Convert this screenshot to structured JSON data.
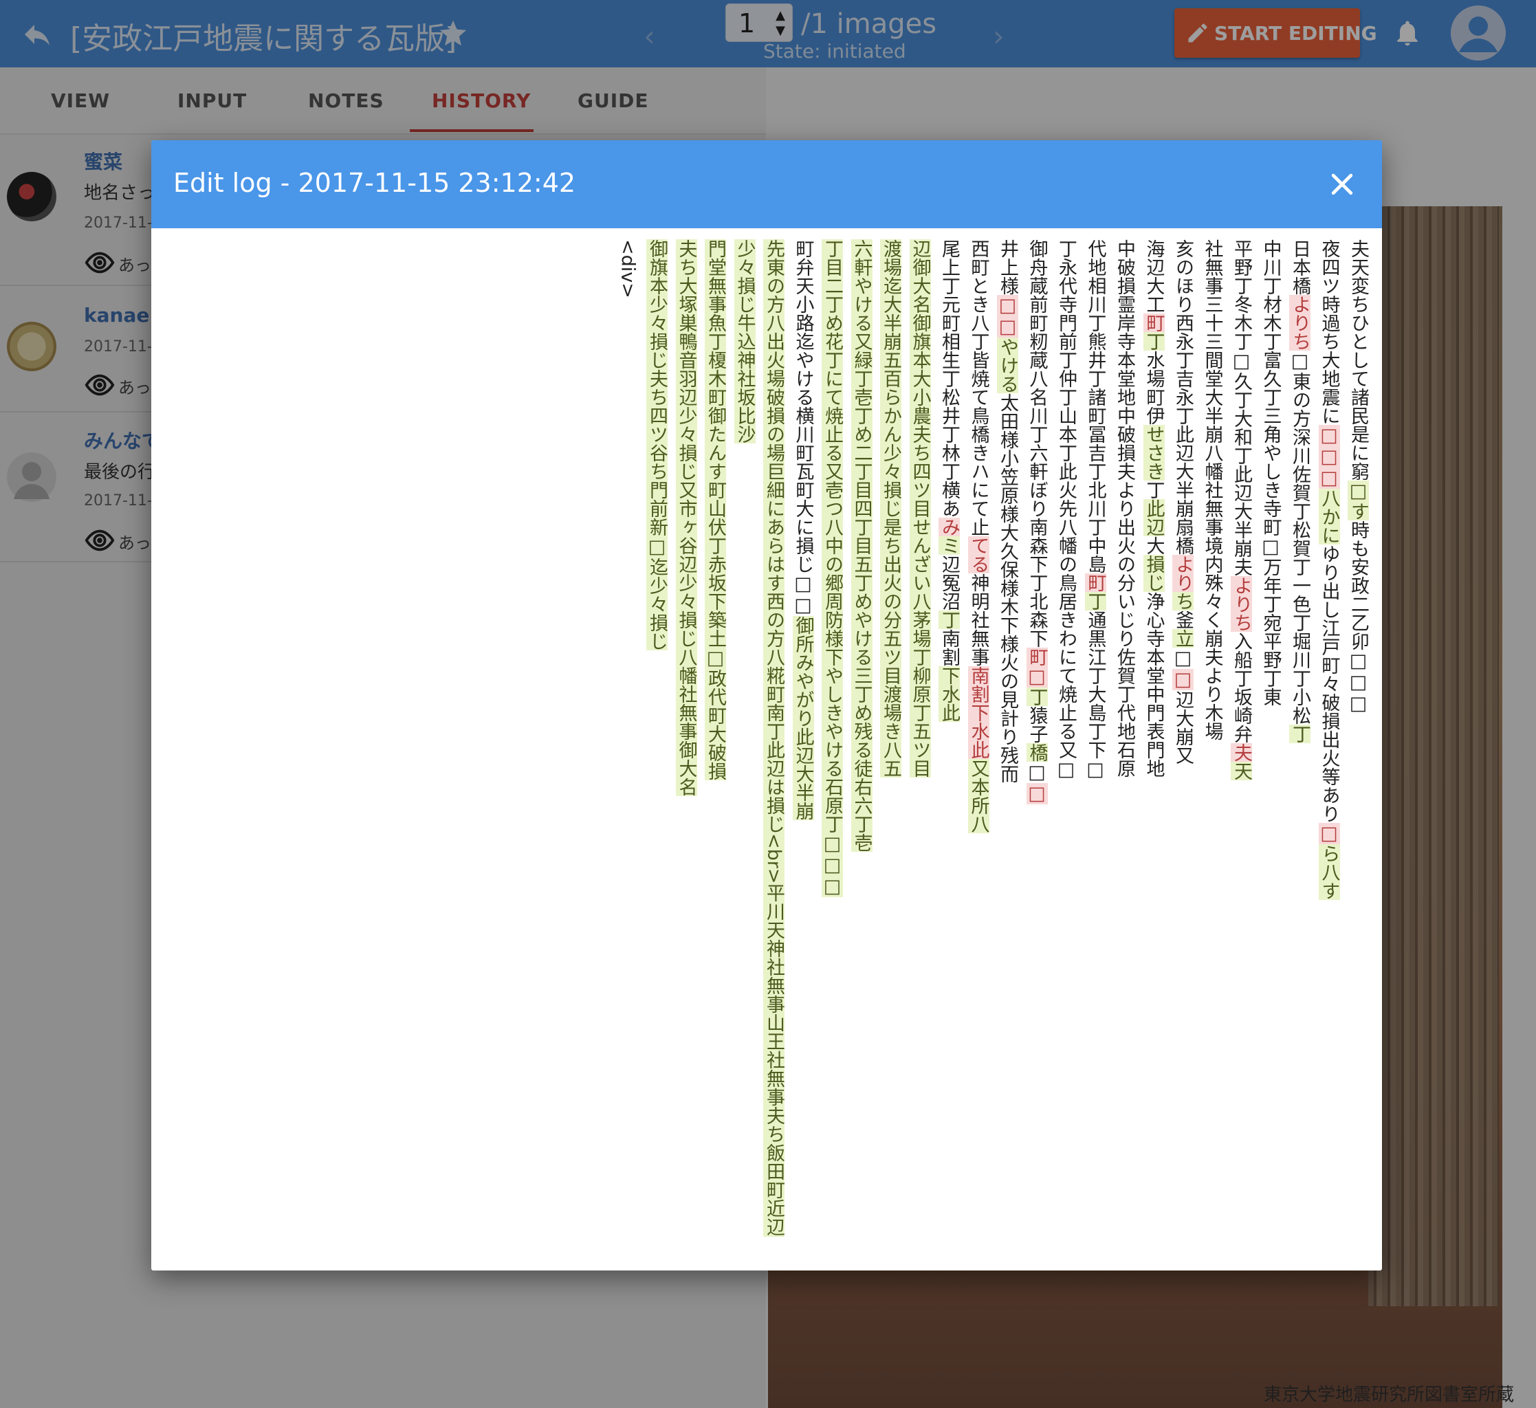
{
  "header": {
    "title": "[安政江戸地震に関する瓦版]",
    "page_current": "1",
    "images_label": "/1 images",
    "state_label": "State: initiated",
    "edit_button_label": "START EDITING",
    "icons": [
      "back-arrow-icon",
      "star-icon",
      "chevron-left-icon",
      "chevron-right-icon",
      "pencil-icon",
      "bell-icon",
      "user-avatar-icon"
    ]
  },
  "tabs": [
    "VIEW",
    "INPUT",
    "NOTES",
    "HISTORY",
    "GUIDE"
  ],
  "active_tab": "HISTORY",
  "history": [
    {
      "user": "蜜菜",
      "message": "地名さっ",
      "date": "2017-11-",
      "view_label": "あっ"
    },
    {
      "user": "kanae",
      "message": "",
      "date": "2017-11-",
      "view_label": "あっ"
    },
    {
      "user": "みんなで",
      "message": "最後の行",
      "date": "2017-11-",
      "view_label": "あっ"
    }
  ],
  "credit": "東京大学地震研究所図書室所蔵",
  "modal": {
    "title": "Edit log - 2017-11-15 23:12:42",
    "columns": [
      [
        {
          "t": "夫天変ちひとして諸民是に窮"
        },
        {
          "t": "□す",
          "c": "ins"
        },
        {
          "t": "時も安政二乙卯□□□"
        }
      ],
      [
        {
          "t": "夜四ツ時過ち大地震に"
        },
        {
          "t": "□□□",
          "c": "del"
        },
        {
          "t": "八かに",
          "c": "ins"
        },
        {
          "t": "ゆり出し江戸町々破損出火等あり"
        },
        {
          "t": "□",
          "c": "del"
        },
        {
          "t": "ら八す",
          "c": "ins"
        }
      ],
      [
        {
          "t": "日本橋"
        },
        {
          "t": "よりち",
          "c": "del"
        },
        {
          "t": "□東の方深川佐賀丁松賀丁一色丁堀川丁小松"
        },
        {
          "t": "丁",
          "c": "ins"
        }
      ],
      [
        {
          "t": "中川丁材木丁富久丁三角やしき寺町□万年丁宛平野丁東"
        }
      ],
      [
        {
          "t": "平野丁冬木丁□久丁大和丁此辺大半崩夫"
        },
        {
          "t": "よりち",
          "c": "del"
        },
        {
          "t": "入船丁坂崎弁"
        },
        {
          "t": "夫",
          "c": "del"
        },
        {
          "t": "天",
          "c": "ins"
        }
      ],
      [
        {
          "t": "社無事三十三間堂大半崩八幡社無事境内殊々く崩夫より木場"
        }
      ],
      [
        {
          "t": "亥のほり西永丁吉永丁此辺大半崩扇橋"
        },
        {
          "t": "より",
          "c": "del"
        },
        {
          "t": "ち",
          "c": "ins"
        },
        {
          "t": "釜"
        },
        {
          "t": "立",
          "c": "ins"
        },
        {
          "t": "□"
        },
        {
          "t": "□",
          "c": "del"
        },
        {
          "t": "辺大崩又"
        }
      ],
      [
        {
          "t": "海辺大工"
        },
        {
          "t": "町",
          "c": "del"
        },
        {
          "t": "丁",
          "c": "ins"
        },
        {
          "t": "水場町伊"
        },
        {
          "t": "せさき",
          "c": "ins"
        },
        {
          "t": "丁"
        },
        {
          "t": "此辺",
          "c": "ins"
        },
        {
          "t": "大"
        },
        {
          "t": "損じ",
          "c": "ins"
        },
        {
          "t": "浄心寺本堂中門表門地"
        }
      ],
      [
        {
          "t": "中破損霊岸寺本堂地中破損夫より出火の分いじり佐賀丁代地石原"
        }
      ],
      [
        {
          "t": "代地相川丁熊井丁諸町冨吉丁北川丁中島"
        },
        {
          "t": "町",
          "c": "del"
        },
        {
          "t": "丁",
          "c": "ins"
        },
        {
          "t": "通黒江丁大島丁下□"
        }
      ],
      [
        {
          "t": "丁永代寺門前丁仲丁山本丁此火先八幡の鳥居きわにて焼止る又□"
        }
      ],
      [
        {
          "t": "御舟蔵前町籾蔵八名川丁六軒ぼり南森下丁北森下"
        },
        {
          "t": "町□",
          "c": "del"
        },
        {
          "t": "丁",
          "c": "ins"
        },
        {
          "t": "猿子"
        },
        {
          "t": "橋",
          "c": "ins"
        },
        {
          "t": "□"
        },
        {
          "t": "□",
          "c": "del"
        }
      ],
      [
        {
          "t": "井上様"
        },
        {
          "t": "□□",
          "c": "del"
        },
        {
          "t": "やける",
          "c": "ins"
        },
        {
          "t": "太田様小笠原様大久保様木下様火の見計り残而"
        }
      ],
      [
        {
          "t": "西町とき八丁皆焼て鳥橋きハにて止"
        },
        {
          "t": "てる",
          "c": "del"
        },
        {
          "t": "神明社無事"
        },
        {
          "t": "南割下水此",
          "c": "del"
        },
        {
          "t": "又本所八",
          "c": "ins"
        }
      ],
      [
        {
          "t": "尾上丁元町相生丁松井丁林丁横あ"
        },
        {
          "t": "み",
          "c": "del"
        },
        {
          "t": "ミ",
          "c": "ins"
        },
        {
          "t": "辺冤沼"
        },
        {
          "t": "丁",
          "c": "ins"
        },
        {
          "t": "南割"
        },
        {
          "t": "下水此",
          "c": "ins"
        }
      ],
      [
        {
          "t": "辺御大名御旗本大小農夫ち四ツ目せんざい八茅場丁柳原丁五ツ目",
          "c": "ins"
        }
      ],
      [
        {
          "t": "渡場迄大半崩五百らかん少々損じ是ち出火の分五ツ目渡場き八五",
          "c": "ins"
        }
      ],
      [
        {
          "t": "六軒やける又緑丁壱丁め二丁目四丁目五丁めやける三丁め残る徒右六丁壱",
          "c": "ins"
        }
      ],
      [
        {
          "t": "丁目二丁め花丁にて焼止る又壱つ八中の郷周防様下やしきやける石原丁□□□",
          "c": "ins"
        }
      ],
      [
        {
          "t": "町弁天小路迄やける横川町瓦町大に損じ□□"
        },
        {
          "t": "御所みやがり此辺大半崩",
          "c": "ins"
        }
      ],
      [
        {
          "t": "先東の方八出火場破損の場巨細にあらはす西の方八糀町南丁此辺は損じ<br>平川天神社無事山王社無事夫ち飯田町近辺",
          "c": "ins"
        }
      ],
      [
        {
          "t": "少々損じ牛込神社坂比沙",
          "c": "ins"
        }
      ],
      [
        {
          "t": "門堂無事魚丁榎木町御たんす町山伏丁赤坂下築土□政代町大破損",
          "c": "ins"
        }
      ],
      [
        {
          "t": "夫ち大塚巣鴨音羽辺少々損じ又市ヶ谷辺少々損じ八幡社無事御大名",
          "c": "ins"
        }
      ],
      [
        {
          "t": "御旗本少々損じ夫ち四ツ谷ち門前新□迄少々損じ",
          "c": "ins"
        }
      ],
      [
        {
          "t": "<div>"
        }
      ]
    ]
  }
}
